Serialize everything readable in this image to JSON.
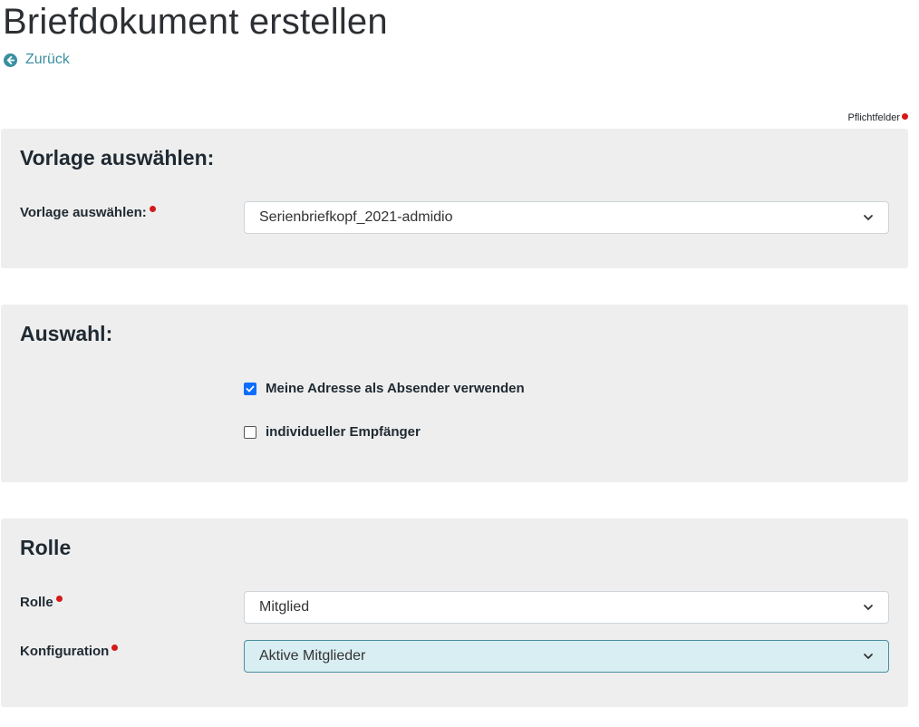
{
  "page": {
    "title": "Briefdokument erstellen",
    "back_label": "Zurück",
    "required_note": "Pflichtfelder"
  },
  "colors": {
    "link": "#3a8fa1",
    "required_dot": "#d41a1a",
    "checkbox_checked": "#0d6efd",
    "card_background": "#eeeeee",
    "focused_select_background": "#d8eef2"
  },
  "template_section": {
    "heading": "Vorlage auswählen:",
    "field_label": "Vorlage auswählen:",
    "selected_value": "Serienbriefkopf_2021-admidio"
  },
  "selection_section": {
    "heading": "Auswahl:",
    "options": [
      {
        "label": "Meine Adresse als Absender verwenden",
        "checked": true
      },
      {
        "label": "individueller Empfänger",
        "checked": false
      }
    ]
  },
  "role_section": {
    "heading": "Rolle",
    "role_label": "Rolle",
    "role_value": "Mitglied",
    "config_label": "Konfiguration",
    "config_value": "Aktive Mitglieder"
  },
  "icons": {
    "back": "arrow-left-circle-icon",
    "select": "chevron-down-icon",
    "check": "check-icon"
  }
}
